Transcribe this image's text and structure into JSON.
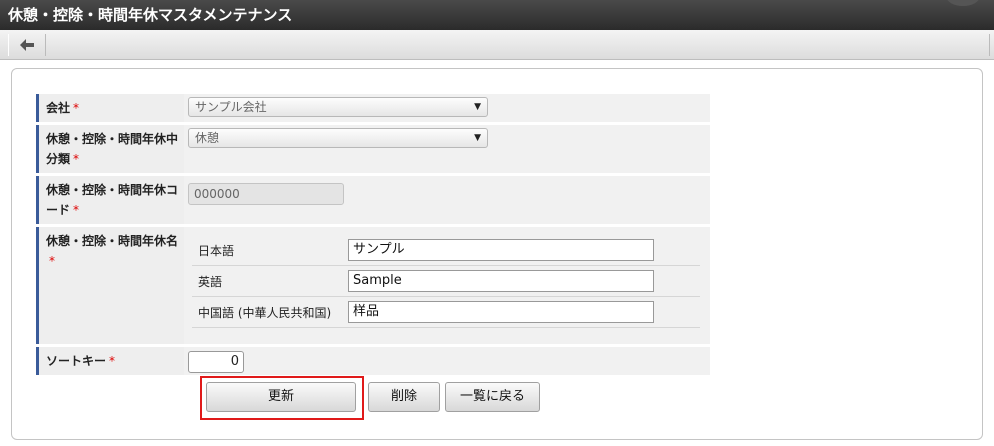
{
  "window": {
    "title": "休憩・控除・時間年休マスタメンテナンス"
  },
  "toolbar": {
    "back_icon": "arrow-left-icon"
  },
  "form": {
    "company": {
      "label": "会社",
      "required_mark": "*",
      "value": "サンプル会社"
    },
    "category": {
      "label": "休憩・控除・時間年休中分類",
      "required_mark": "*",
      "value": "休憩"
    },
    "code": {
      "label": "休憩・控除・時間年休コード",
      "required_mark": "*",
      "value": "000000"
    },
    "name": {
      "label": "休憩・控除・時間年休名",
      "required_mark": "*",
      "rows": [
        {
          "lang": "日本語",
          "value": "サンプル"
        },
        {
          "lang": "英語",
          "value": "Sample"
        },
        {
          "lang": "中国語 (中華人民共和国)",
          "value": "样品"
        }
      ]
    },
    "sort_key": {
      "label": "ソートキー",
      "required_mark": "*",
      "value": "0"
    }
  },
  "buttons": {
    "update": "更新",
    "delete": "削除",
    "back_to_list": "一覧に戻る"
  },
  "colors": {
    "title_bar": "#333333",
    "label_accent": "#3a5b9a",
    "highlight": "#e01a1a"
  }
}
